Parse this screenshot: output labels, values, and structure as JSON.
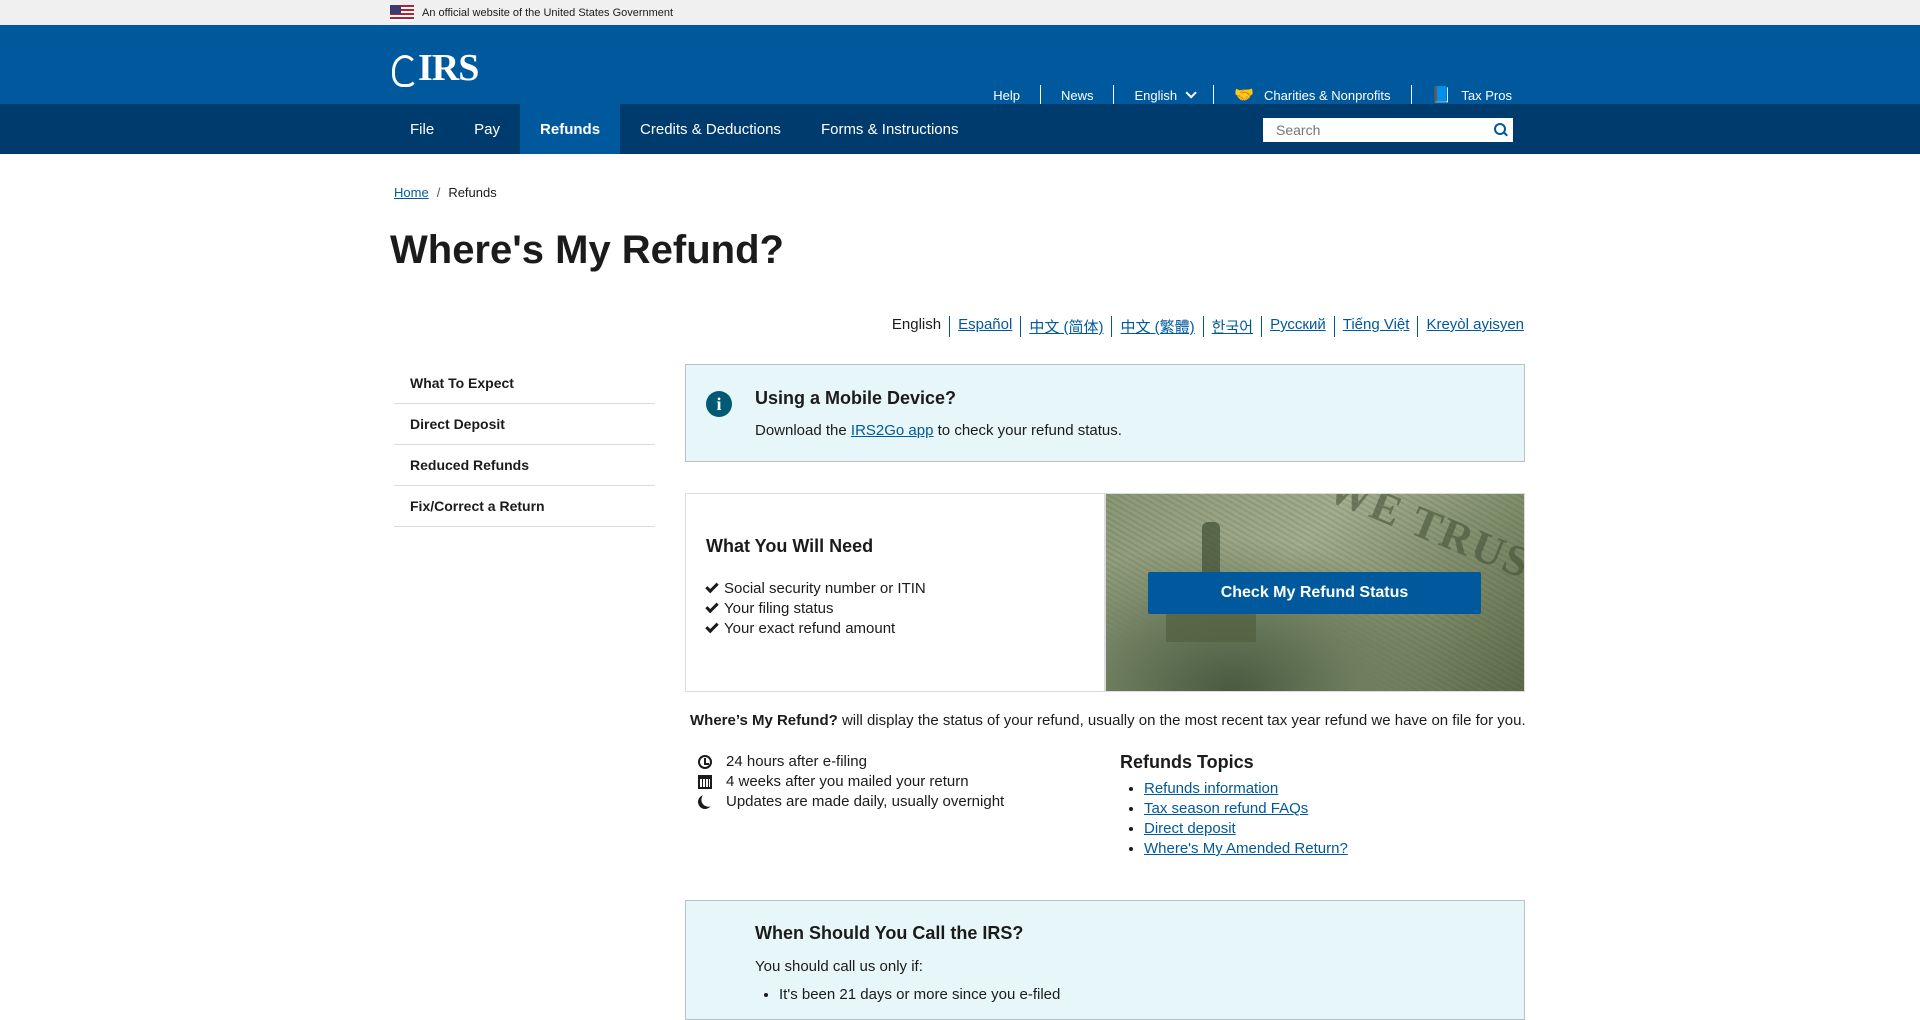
{
  "gov_banner": {
    "text": "An official website of the United States Government"
  },
  "header": {
    "logo_text": "IRS",
    "util_links": [
      {
        "label": "Help"
      },
      {
        "label": "News"
      },
      {
        "label": "English"
      },
      {
        "label": "Charities & Nonprofits"
      },
      {
        "label": "Tax Pros"
      }
    ]
  },
  "mainnav": {
    "items": [
      {
        "label": "File"
      },
      {
        "label": "Pay"
      },
      {
        "label": "Refunds"
      },
      {
        "label": "Credits & Deductions"
      },
      {
        "label": "Forms & Instructions"
      }
    ],
    "active": "Refunds",
    "search_placeholder": "Search"
  },
  "breadcrumb": {
    "home": "Home",
    "sep": "/",
    "current": "Refunds"
  },
  "page_title": "Where's My Refund?",
  "languages": {
    "current": "English",
    "links": [
      "Español",
      "中文 (简体)",
      "中文 (繁體)",
      "한국어",
      "Русский",
      "Tiếng Việt",
      "Kreyòl ayisyen"
    ]
  },
  "sidenav": {
    "items": [
      "What To Expect",
      "Direct Deposit",
      "Reduced Refunds",
      "Fix/Correct a Return"
    ]
  },
  "mobile_alert": {
    "title": "Using a Mobile Device?",
    "text_before": "Download the ",
    "link": "IRS2Go app",
    "text_after": " to check your refund status."
  },
  "need_card": {
    "title": "What You Will Need",
    "items": [
      "Social security number or ITIN",
      "Your filing status",
      "Your exact refund amount"
    ]
  },
  "hero": {
    "image_text": "WE TRUST",
    "cta_label": "Check My Refund Status"
  },
  "description": {
    "bold": "Where’s My Refund?",
    "rest": " will display the status of your refund, usually on the most recent tax year refund we have on file for you."
  },
  "timing": [
    {
      "icon": "clock-icon",
      "text": "24 hours after e-filing"
    },
    {
      "icon": "calendar-icon",
      "text": "4 weeks after you mailed your return"
    },
    {
      "icon": "moon-icon",
      "text": "Updates are made daily, usually overnight"
    }
  ],
  "topics": {
    "title": "Refunds Topics",
    "links": [
      "Refunds information",
      "Tax season refund FAQs",
      "Direct deposit",
      "Where's My Amended Return?"
    ]
  },
  "call_box": {
    "title": "When Should You Call the IRS?",
    "intro": "You should call us only if:",
    "items": [
      "It's been 21 days or more since you e-filed"
    ]
  },
  "colors": {
    "header_blue": "#00599c",
    "nav_dark": "#003b6e",
    "alert_bg": "#e7f6f8"
  }
}
